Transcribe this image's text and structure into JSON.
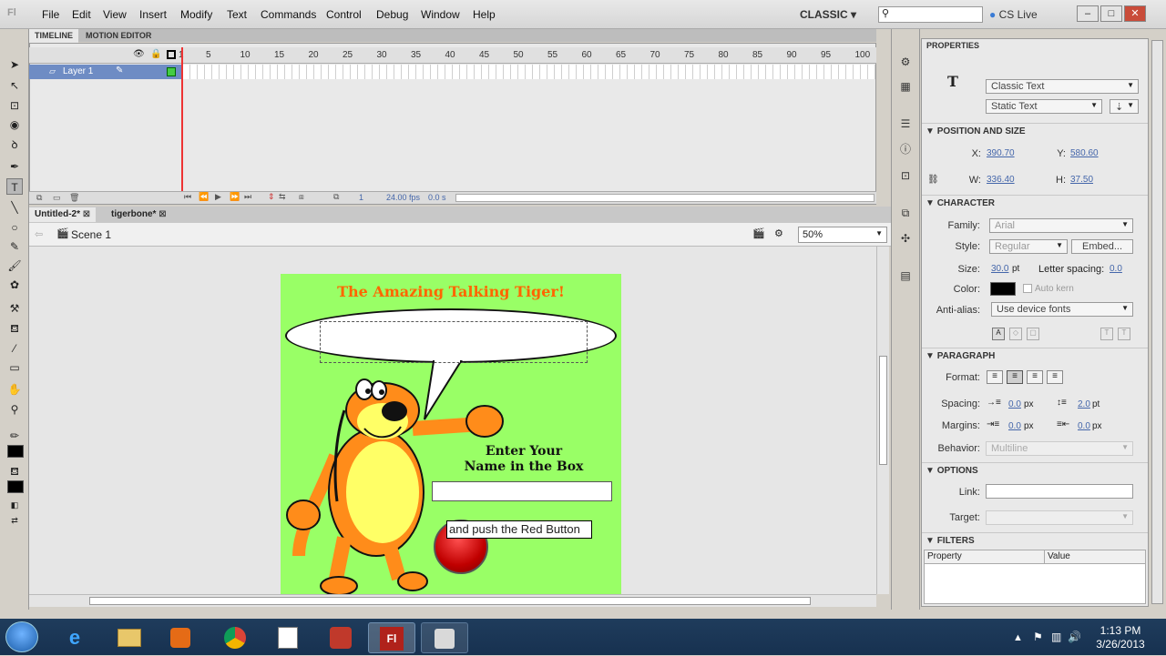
{
  "app": {
    "logo": "Fl"
  },
  "menu": [
    "File",
    "Edit",
    "View",
    "Insert",
    "Modify",
    "Text",
    "Commands",
    "Control",
    "Debug",
    "Window",
    "Help"
  ],
  "workspace": "CLASSIC",
  "cslive": "CS Live",
  "timeline": {
    "tabs": [
      "TIMELINE",
      "MOTION EDITOR"
    ],
    "frame_numbers": [
      "1",
      "5",
      "10",
      "15",
      "20",
      "25",
      "30",
      "35",
      "40",
      "45",
      "50",
      "55",
      "60",
      "65",
      "70",
      "75",
      "80",
      "85",
      "90",
      "95",
      "100"
    ],
    "layer_name": "Layer 1",
    "current_frame": "1",
    "fps": "24.00 fps",
    "elapsed": "0.0 s"
  },
  "docs": {
    "tabs": [
      "Untitled-2*",
      "tigerbone*"
    ]
  },
  "scene": {
    "label": "Scene 1",
    "zoom": "50%"
  },
  "stage": {
    "title": "The Amazing Talking Tiger!",
    "enter_line1": "Enter Your",
    "enter_line2": "Name in the Box",
    "push_text": "and push the Red Button"
  },
  "properties": {
    "tab": "PROPERTIES",
    "text_engine": "Classic Text",
    "text_type": "Static Text",
    "sections": {
      "position": "POSITION AND SIZE",
      "character": "CHARACTER",
      "paragraph": "PARAGRAPH",
      "options": "OPTIONS",
      "filters": "FILTERS"
    },
    "x_label": "X:",
    "x": "390.70",
    "y_label": "Y:",
    "y": "580.60",
    "w_label": "W:",
    "w": "336.40",
    "h_label": "H:",
    "h": "37.50",
    "family_label": "Family:",
    "family": "Arial",
    "style_label": "Style:",
    "style": "Regular",
    "embed": "Embed...",
    "size_label": "Size:",
    "size": "30.0",
    "size_unit": "pt",
    "letter_spacing_label": "Letter spacing:",
    "letter_spacing": "0.0",
    "color_label": "Color:",
    "auto_kern": "Auto kern",
    "antialias_label": "Anti-alias:",
    "antialias": "Use device fonts",
    "format_label": "Format:",
    "spacing_label": "Spacing:",
    "spacing_indent": "0.0",
    "spacing_indent_unit": "px",
    "spacing_line": "2.0",
    "spacing_line_unit": "pt",
    "margins_label": "Margins:",
    "margin_left": "0.0",
    "margin_left_unit": "px",
    "margin_right": "0.0",
    "margin_right_unit": "px",
    "behavior_label": "Behavior:",
    "behavior": "Multiline",
    "link_label": "Link:",
    "target_label": "Target:",
    "filters_col_property": "Property",
    "filters_col_value": "Value"
  },
  "clock": {
    "time": "1:13 PM",
    "date": "3/26/2013"
  }
}
